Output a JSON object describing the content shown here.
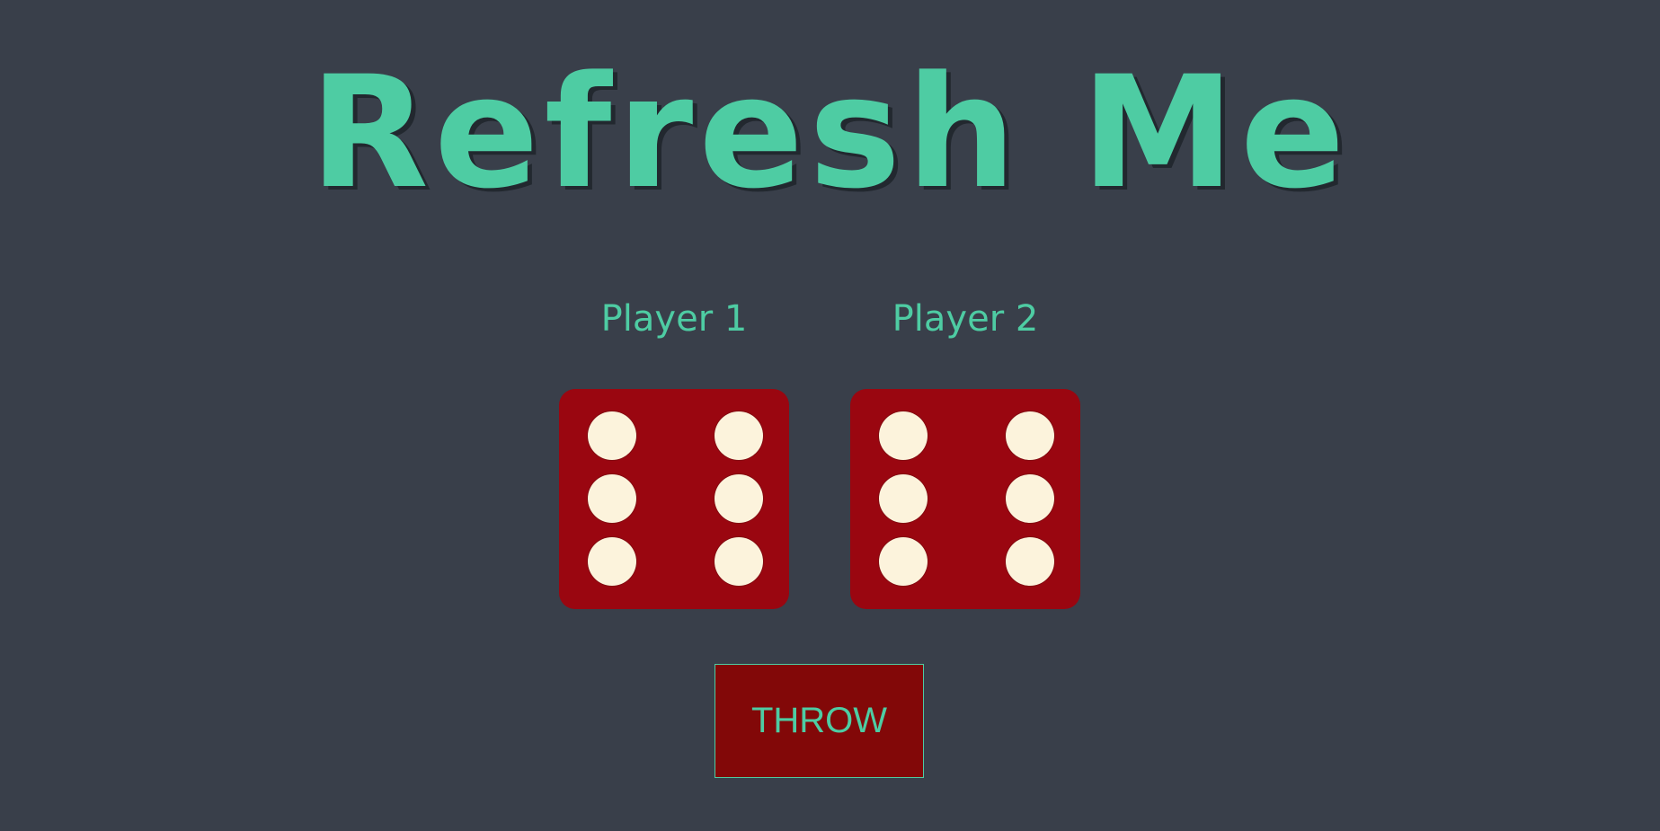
{
  "title": "Refresh Me",
  "colors": {
    "background": "#393f4a",
    "accent": "#4ecca3",
    "die": "#9a0610",
    "pip": "#fcf3dc",
    "button": "#820808"
  },
  "players": [
    {
      "label": "Player 1",
      "die_value": 6
    },
    {
      "label": "Player 2",
      "die_value": 6
    }
  ],
  "throw_button": {
    "label": "THROW"
  }
}
